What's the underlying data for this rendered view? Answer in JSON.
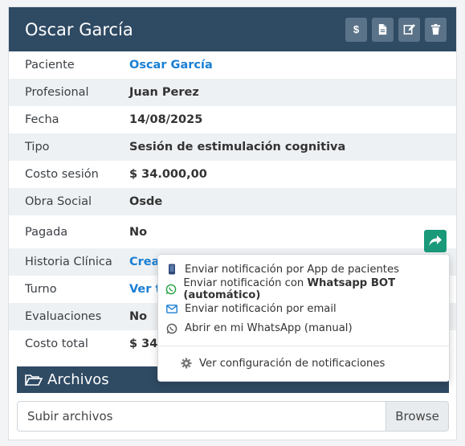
{
  "header": {
    "title": "Oscar García",
    "actions": [
      {
        "name": "money-icon"
      },
      {
        "name": "document-icon"
      },
      {
        "name": "edit-icon"
      },
      {
        "name": "trash-icon"
      }
    ]
  },
  "details": {
    "paciente": {
      "label": "Paciente",
      "value": "Oscar García"
    },
    "profesional": {
      "label": "Profesional",
      "value": "Juan Perez"
    },
    "fecha": {
      "label": "Fecha",
      "value": "14/08/2025"
    },
    "tipo": {
      "label": "Tipo",
      "value": "Sesión de estimulación cognitiva"
    },
    "costo_sesion": {
      "label": "Costo sesión",
      "value": "$ 34.000,00"
    },
    "obra_social": {
      "label": "Obra Social",
      "value": "Osde"
    },
    "pagada": {
      "label": "Pagada",
      "value": "No"
    },
    "historia": {
      "label": "Historia Clínica",
      "value": "Crea"
    },
    "turno": {
      "label": "Turno",
      "value": "Ver t"
    },
    "evaluaciones": {
      "label": "Evaluaciones",
      "value": "No"
    },
    "costo_total": {
      "label": "Costo total",
      "value": "$ 34."
    }
  },
  "files": {
    "title": "Archivos",
    "upload_label": "Subir archivos",
    "browse_label": "Browse"
  },
  "notify_menu": {
    "app": "Enviar notificación por App de pacientes",
    "whatsapp_bot_prefix": "Enviar notificación con ",
    "whatsapp_bot_bold": "Whatsapp BOT (automático)",
    "email": "Enviar notificación por email",
    "whatsapp_manual": "Abrir en mi WhatsApp (manual)",
    "config": "Ver configuración de notificaciones"
  },
  "colors": {
    "header": "#2f4a63",
    "link": "#1a7fd4",
    "share": "#1b9a7a"
  }
}
